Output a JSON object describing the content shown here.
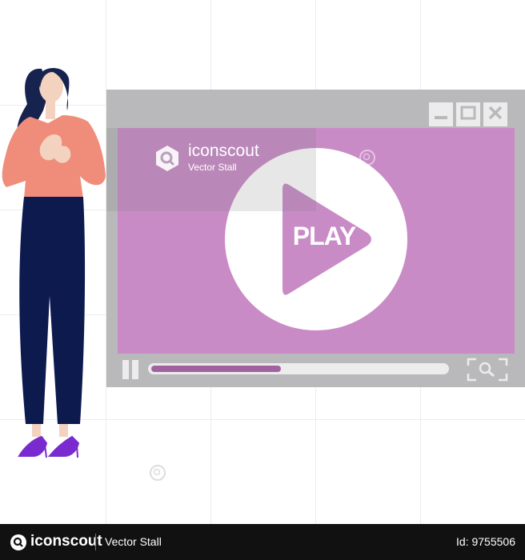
{
  "player": {
    "play_label": "PLAY",
    "progress_fraction": 0.44,
    "colors": {
      "frame": "#b9b9bb",
      "screen": "#c98bc6",
      "progress_fill": "#a063a0",
      "controls": "#ececec"
    }
  },
  "window_controls": {
    "icons": [
      "minimize-icon",
      "maximize-icon",
      "close-icon"
    ]
  },
  "watermark": {
    "brand": "iconscout",
    "subtitle": "Vector Stall"
  },
  "footer": {
    "brand": "iconscout",
    "author": "Vector Stall",
    "asset_id": "Id: 9755506"
  }
}
